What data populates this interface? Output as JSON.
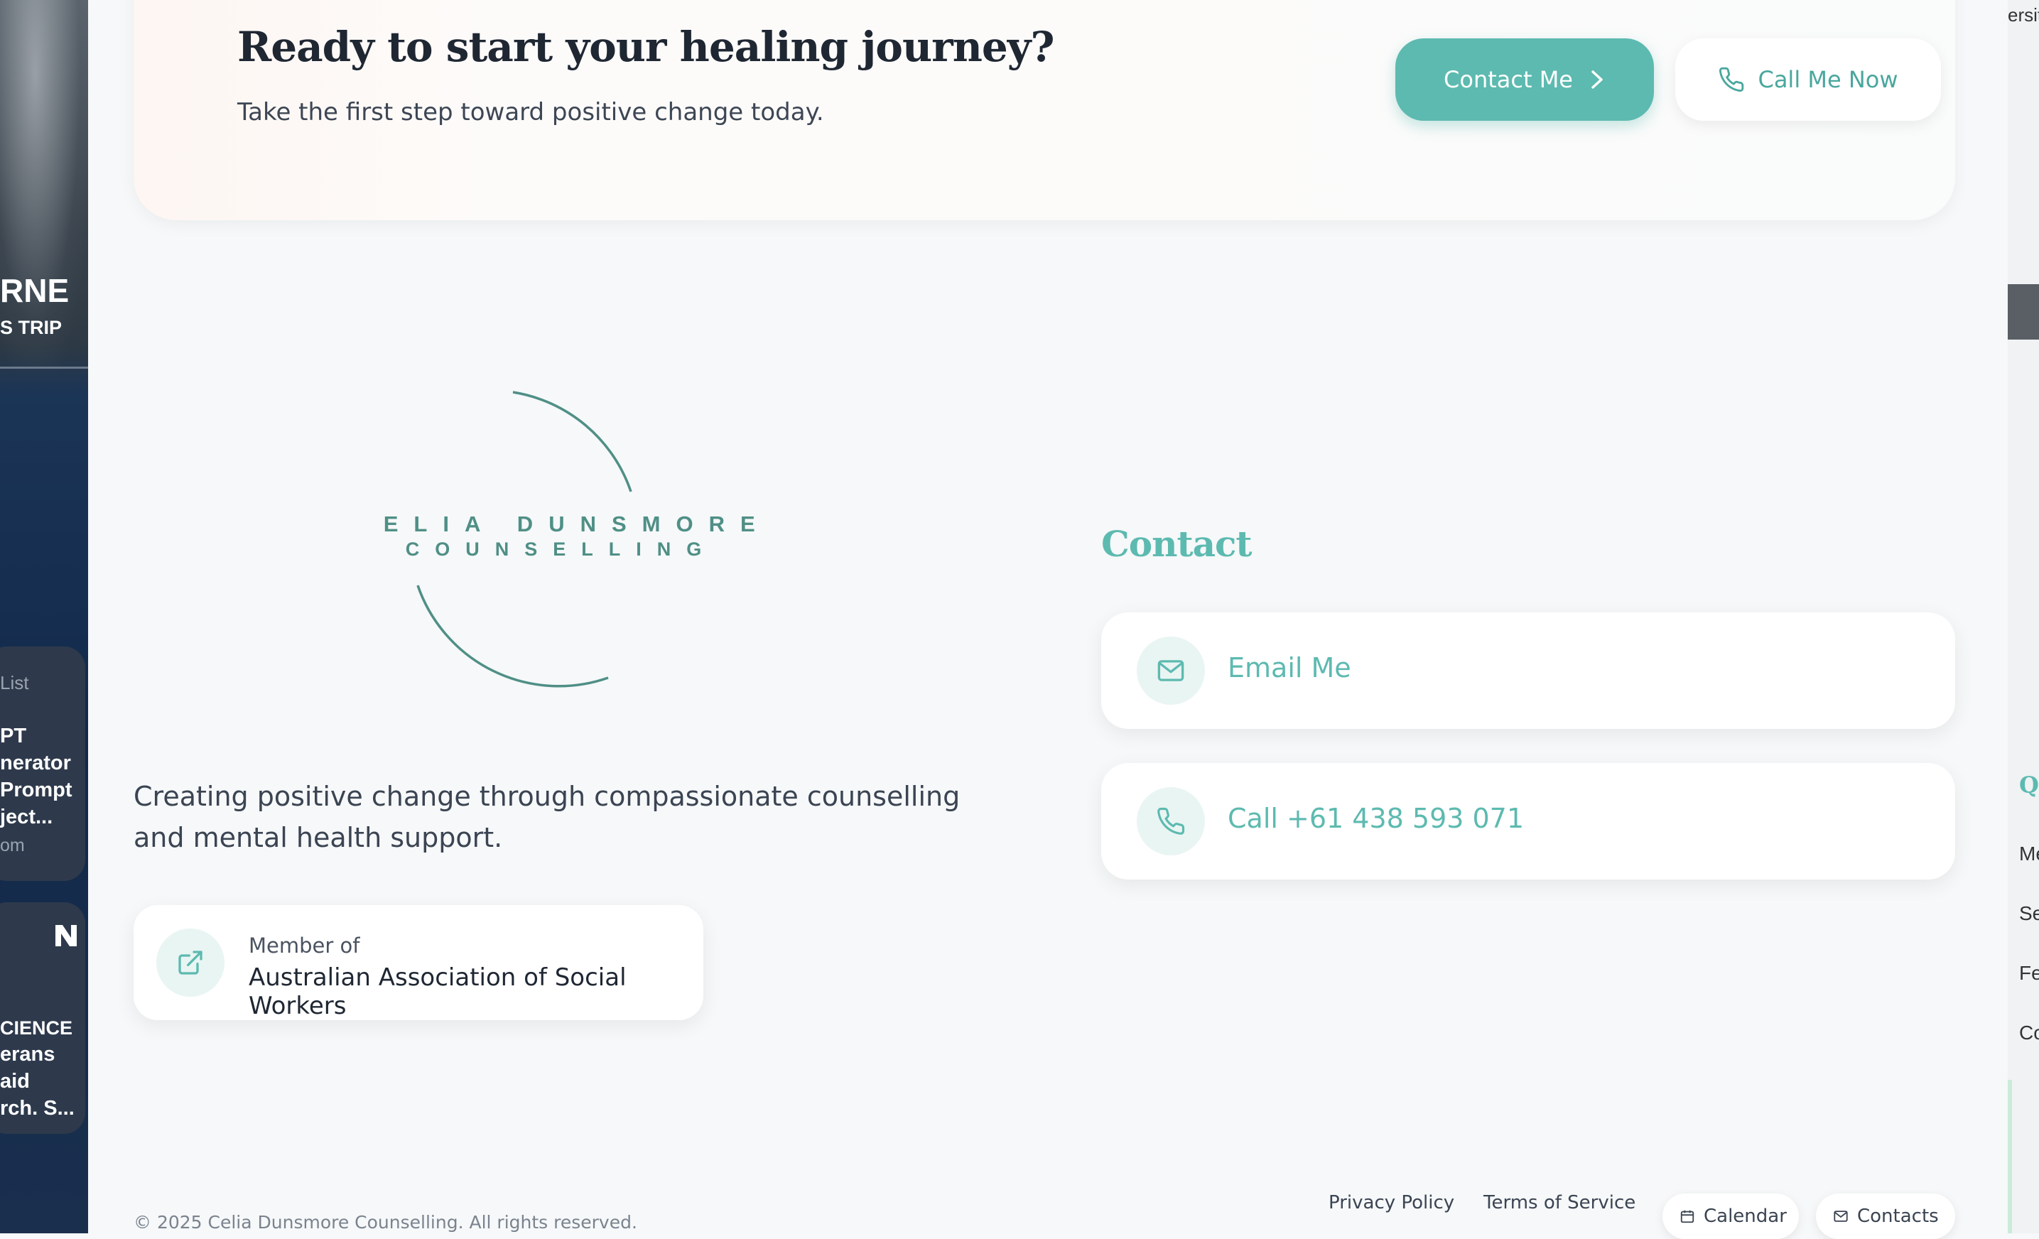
{
  "left_panel": {
    "headline_1": "RNE",
    "headline_2": "S TRIP",
    "card1_label": "List",
    "card1_lines": [
      "PT",
      "nerator",
      "Prompt",
      "ject..."
    ],
    "card1_source": "om",
    "card2_lines": [
      "CIENCE",
      "erans",
      "aid",
      "rch. S..."
    ]
  },
  "right_panel": {
    "top_text": "ersit",
    "heading": "Q",
    "items": [
      "Me",
      "Se",
      "Fe",
      "Co"
    ]
  },
  "cta": {
    "title": "Ready to start your healing journey?",
    "subtitle": "Take the first step toward positive change today.",
    "contact_button": "Contact Me",
    "call_button": "Call Me Now"
  },
  "logo": {
    "line1": "CELIA DUNSMORE",
    "line2": "COUNSELLING"
  },
  "about": {
    "tagline": "Creating positive change through compassionate counselling and mental health support.",
    "member_small": "Member of",
    "member_org": "Australian Association of Social Workers"
  },
  "contact": {
    "heading": "Contact",
    "email_label": "Email Me",
    "phone_label": "Call +61 438 593 071"
  },
  "footer": {
    "copyright": "© 2025 Celia Dunsmore Counselling. All rights reserved.",
    "privacy": "Privacy Policy",
    "terms": "Terms of Service",
    "calendar": "Calendar",
    "contacts": "Contacts"
  },
  "colors": {
    "accent": "#5dbab0",
    "dark_text": "#1f2733",
    "logo_teal": "#4f8f86"
  }
}
